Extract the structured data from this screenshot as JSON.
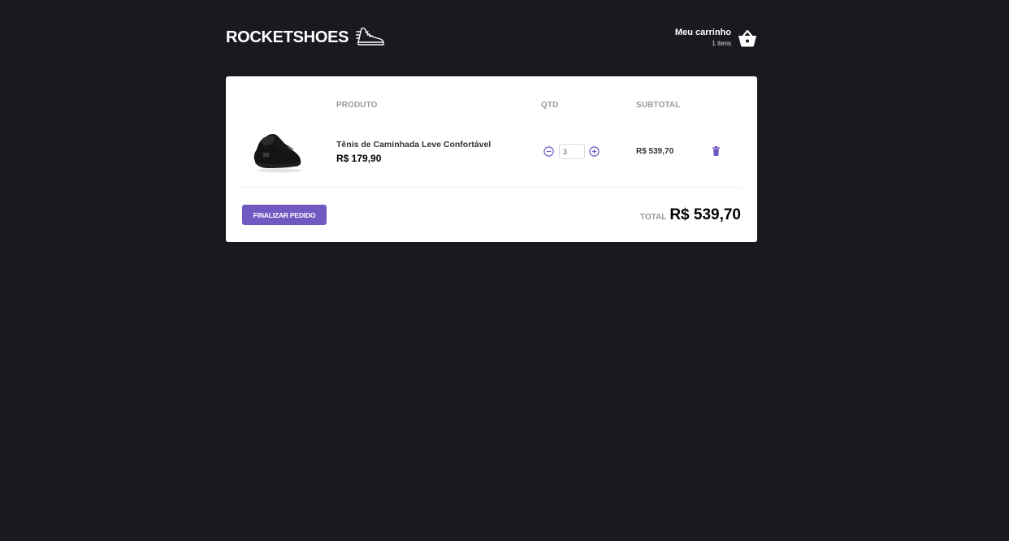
{
  "header": {
    "logo_text": "ROCKETSHOES",
    "cart_title": "Meu carrinho",
    "cart_count": "1 itens"
  },
  "table": {
    "headers": {
      "product": "PRODUTO",
      "qty": "QTD",
      "subtotal": "SUBTOTAL"
    },
    "rows": [
      {
        "title": "Tênis de Caminhada Leve Confortável",
        "price": "R$ 179,90",
        "quantity": "3",
        "subtotal": "R$ 539,70"
      }
    ]
  },
  "footer": {
    "finish_label": "FINALIZAR PEDIDO",
    "total_label": "TOTAL",
    "total_value": "R$ 539,70"
  },
  "icons": {
    "logo": "sneaker-icon",
    "cart": "basket-icon",
    "decrement": "minus-circle-icon",
    "increment": "plus-circle-icon",
    "remove": "trash-icon"
  },
  "colors": {
    "background": "#191920",
    "accent": "#7159c1",
    "panel": "#ffffff",
    "muted": "#999999"
  }
}
